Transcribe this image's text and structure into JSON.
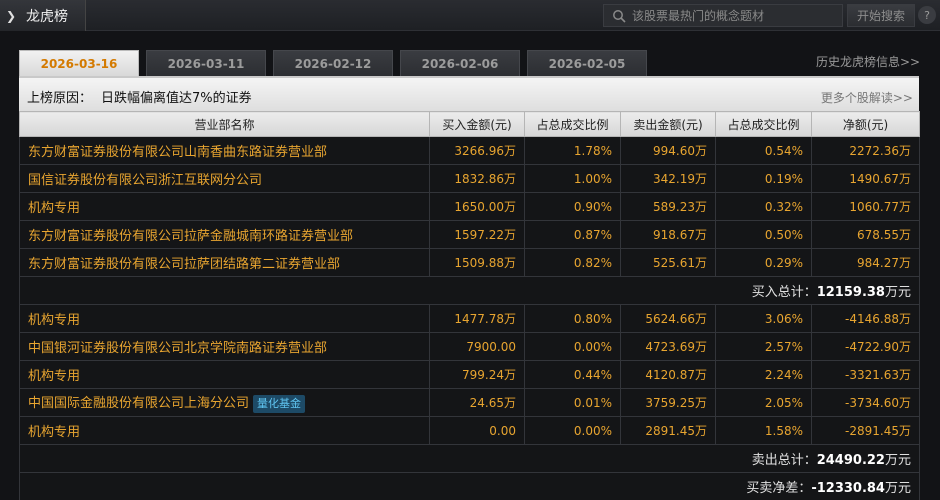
{
  "header": {
    "title": "龙虎榜",
    "search_placeholder": "该股票最热门的概念题材",
    "search_button": "开始搜索",
    "help": "?"
  },
  "tabs": [
    {
      "label": "2026-03-16",
      "active": true
    },
    {
      "label": "2026-03-11",
      "active": false
    },
    {
      "label": "2026-02-12",
      "active": false
    },
    {
      "label": "2026-02-06",
      "active": false
    },
    {
      "label": "2026-02-05",
      "active": false
    }
  ],
  "history_link": "历史龙虎榜信息>>",
  "reason": {
    "label": "上榜原因：",
    "value": "日跌幅偏离值达7%的证券",
    "more_link": "更多个股解读>>"
  },
  "table": {
    "headers": [
      "营业部名称",
      "买入金额(元)",
      "占总成交比例",
      "卖出金额(元)",
      "占总成交比例",
      "净额(元)"
    ],
    "buy_rows": [
      [
        "东方财富证券股份有限公司山南香曲东路证券营业部",
        "3266.96万",
        "1.78%",
        "994.60万",
        "0.54%",
        "2272.36万"
      ],
      [
        "国信证券股份有限公司浙江互联网分公司",
        "1832.86万",
        "1.00%",
        "342.19万",
        "0.19%",
        "1490.67万"
      ],
      [
        "机构专用",
        "1650.00万",
        "0.90%",
        "589.23万",
        "0.32%",
        "1060.77万"
      ],
      [
        "东方财富证券股份有限公司拉萨金融城南环路证券营业部",
        "1597.22万",
        "0.87%",
        "918.67万",
        "0.50%",
        "678.55万"
      ],
      [
        "东方财富证券股份有限公司拉萨团结路第二证券营业部",
        "1509.88万",
        "0.82%",
        "525.61万",
        "0.29%",
        "984.27万"
      ]
    ],
    "buy_total_label": "买入总计：",
    "buy_total_value": "12159.38",
    "buy_total_unit": "万元",
    "sell_rows": [
      [
        "机构专用",
        "1477.78万",
        "0.80%",
        "5624.66万",
        "3.06%",
        "-4146.88万"
      ],
      [
        "中国银河证券股份有限公司北京学院南路证券营业部",
        "7900.00",
        "0.00%",
        "4723.69万",
        "2.57%",
        "-4722.90万"
      ],
      [
        "机构专用",
        "799.24万",
        "0.44%",
        "4120.87万",
        "2.24%",
        "-3321.63万"
      ],
      [
        "中国国际金融股份有限公司上海分公司",
        "24.65万",
        "0.01%",
        "3759.25万",
        "2.05%",
        "-3734.60万"
      ],
      [
        "机构专用",
        "0.00",
        "0.00%",
        "2891.45万",
        "1.58%",
        "-2891.45万"
      ]
    ],
    "sell_badge": "量化基金",
    "sell_total_label": "卖出总计：",
    "sell_total_value": "24490.22",
    "sell_total_unit": "万元",
    "net_label": "买卖净差：",
    "net_value": "-12330.84",
    "net_unit": "万元"
  }
}
